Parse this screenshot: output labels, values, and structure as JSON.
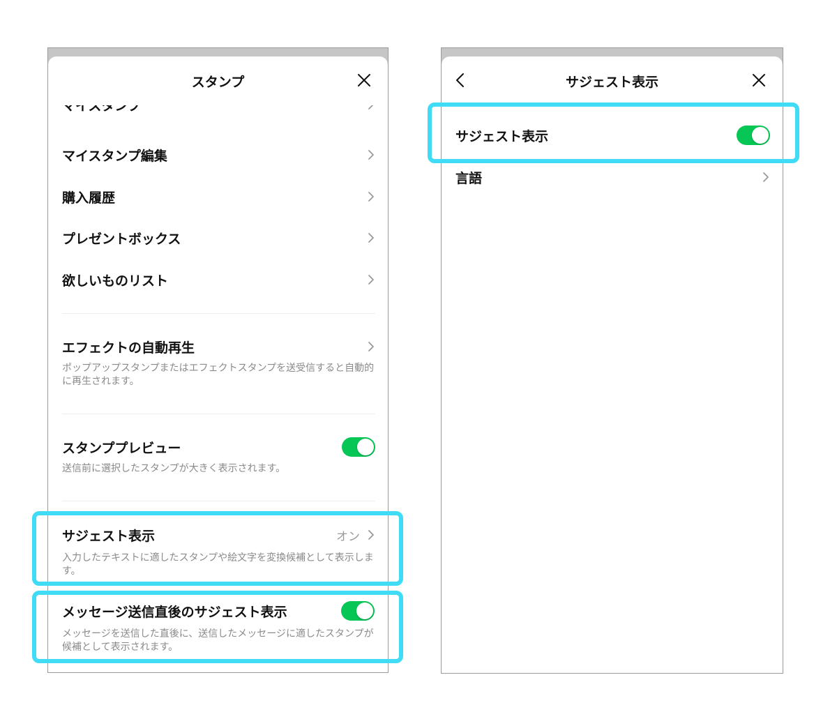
{
  "colors": {
    "accent_toggle_on": "#06c755",
    "highlight": "#40dcf5"
  },
  "left": {
    "title": "スタンプ",
    "close_icon": "close-icon",
    "cut_item_label": "マイスタンプ",
    "items": [
      {
        "label": "マイスタンプ編集"
      },
      {
        "label": "購入履歴"
      },
      {
        "label": "プレゼントボックス"
      },
      {
        "label": "欲しいものリスト"
      }
    ],
    "effect_autoplay": {
      "label": "エフェクトの自動再生",
      "description": "ポップアップスタンプまたはエフェクトスタンプを送受信すると自動的に再生されます。"
    },
    "sticker_preview": {
      "label": "スタンププレビュー",
      "description": "送信前に選択したスタンプが大きく表示されます。",
      "enabled": true
    },
    "suggest": {
      "label": "サジェスト表示",
      "value": "オン",
      "description": "入力したテキストに適したスタンプや絵文字を変換候補として表示します。"
    },
    "suggest_after_send": {
      "label": "メッセージ送信直後のサジェスト表示",
      "description": "メッセージを送信した直後に、送信したメッセージに適したスタンプが候補として表示されます。",
      "enabled": true
    }
  },
  "right": {
    "title": "サジェスト表示",
    "back_icon": "chevron-left-icon",
    "close_icon": "close-icon",
    "suggest_toggle": {
      "label": "サジェスト表示",
      "enabled": true
    },
    "language": {
      "label": "言語"
    }
  }
}
